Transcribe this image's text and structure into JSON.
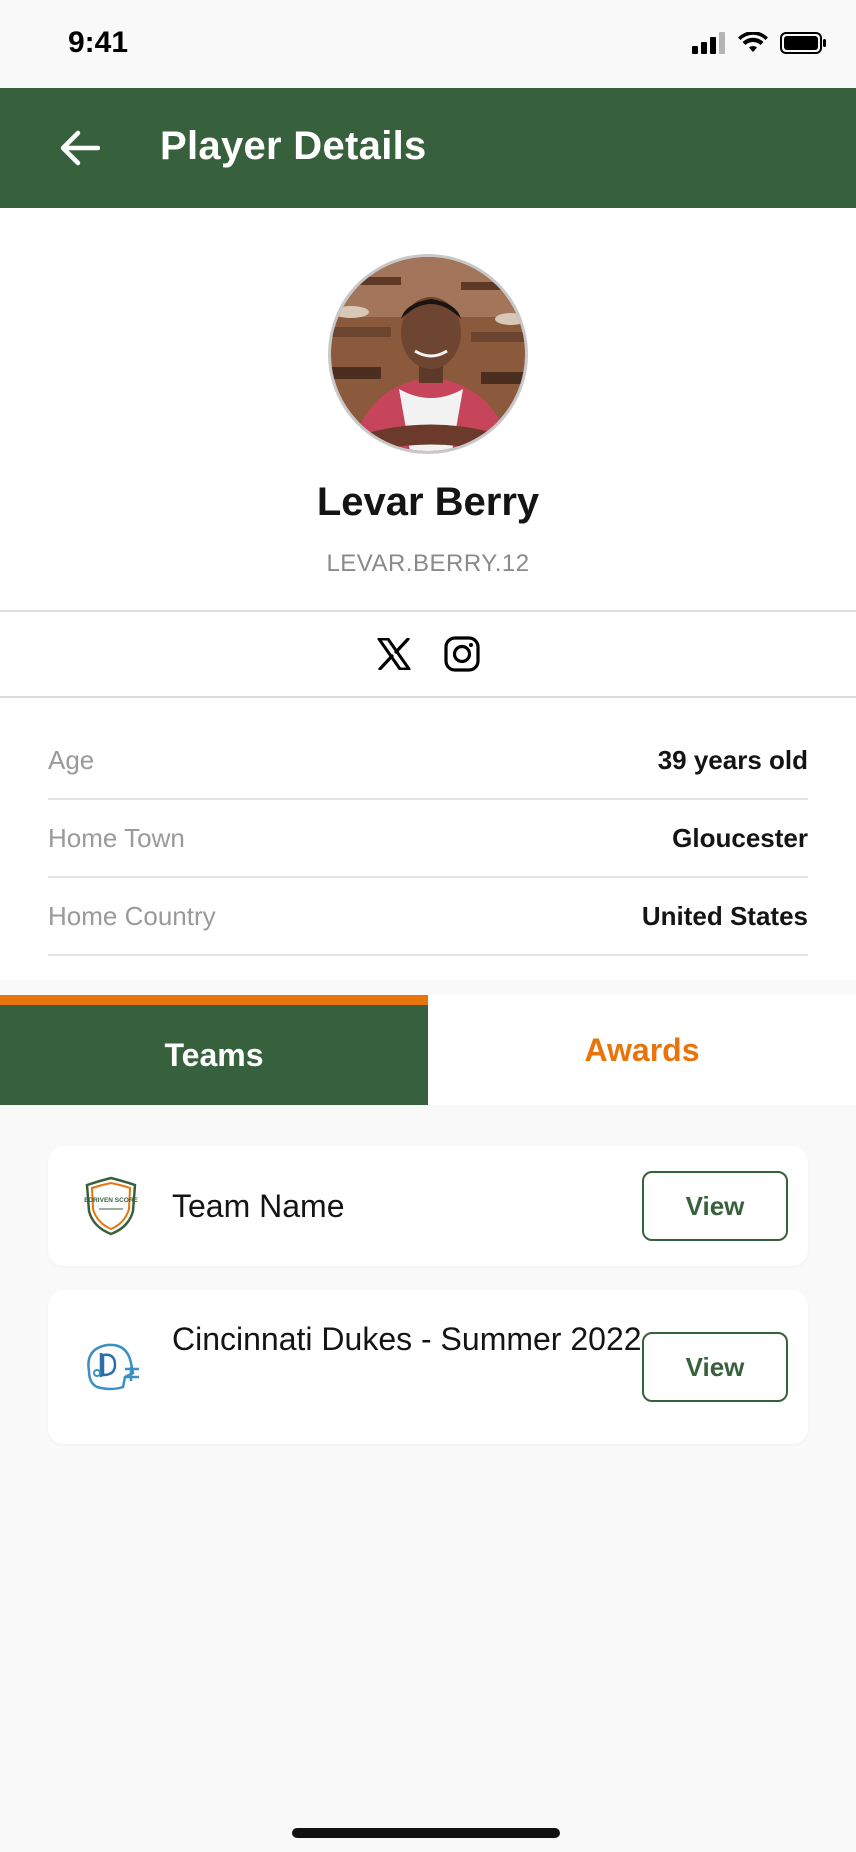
{
  "status_bar": {
    "time": "9:41"
  },
  "header": {
    "title": "Player Details"
  },
  "profile": {
    "name": "Levar Berry",
    "username": "LEVAR.BERRY.12"
  },
  "social": [
    {
      "icon": "x-icon"
    },
    {
      "icon": "instagram-icon"
    }
  ],
  "details": [
    {
      "label": "Age",
      "value": "39 years old"
    },
    {
      "label": "Home Town",
      "value": "Gloucester"
    },
    {
      "label": "Home Country",
      "value": "United States"
    }
  ],
  "tabs": [
    {
      "label": "Teams",
      "active": true
    },
    {
      "label": "Awards",
      "active": false
    }
  ],
  "teams": [
    {
      "name": "Team Name",
      "view_label": "View",
      "logo": "edriven-score-shield-logo",
      "logo_text": "EDRIVEN SCORE"
    },
    {
      "name": "Cincinnati Dukes - Summer 2022",
      "view_label": "View",
      "logo": "football-helmet-logo"
    }
  ],
  "colors": {
    "primary_green": "#37613c",
    "accent_orange": "#e8740c",
    "background": "#f9f9f9"
  }
}
